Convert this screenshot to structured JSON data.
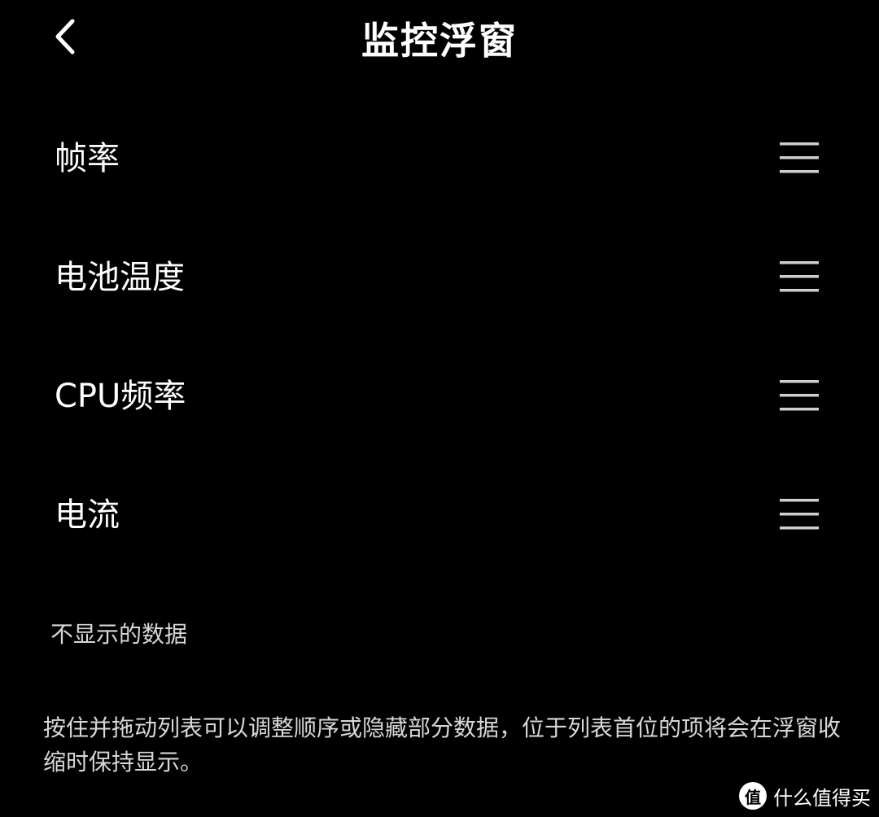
{
  "header": {
    "back_icon": "chevron-left-icon",
    "title": "监控浮窗"
  },
  "items": [
    {
      "label": "帧率",
      "handle_icon": "drag-handle-icon"
    },
    {
      "label": "电池温度",
      "handle_icon": "drag-handle-icon"
    },
    {
      "label": "CPU频率",
      "handle_icon": "drag-handle-icon"
    },
    {
      "label": "电流",
      "handle_icon": "drag-handle-icon"
    }
  ],
  "hidden_section": {
    "label": "不显示的数据"
  },
  "hint": "按住并拖动列表可以调整顺序或隐藏部分数据，位于列表首位的项将会在浮窗收缩时保持显示。",
  "watermark": {
    "logo_text": "值",
    "text": "什么值得买"
  },
  "colors": {
    "background": "#000000",
    "text": "#ffffff",
    "secondary_text": "#d8d8d8",
    "handle": "#cfcfcf"
  }
}
